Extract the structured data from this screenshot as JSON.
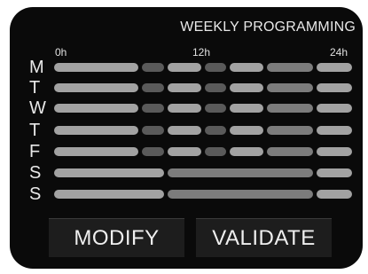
{
  "header": {
    "title": "WEEKLY PROGRAMMING"
  },
  "hours": {
    "start": "0h",
    "mid": "12h",
    "end": "24h"
  },
  "colors": {
    "screen": "#0a0a0a",
    "comfort": "#a2a2a2",
    "eco": "#5a5a5a",
    "mid": "#7c7c7c",
    "text": "#e8e8e8"
  },
  "days": [
    {
      "label": "M",
      "blocks": [
        "comfort",
        "eco",
        "comfort",
        "eco",
        "comfort",
        "mid",
        "comfort"
      ]
    },
    {
      "label": "T",
      "blocks": [
        "comfort",
        "eco",
        "comfort",
        "eco",
        "comfort",
        "mid",
        "comfort"
      ]
    },
    {
      "label": "W",
      "blocks": [
        "comfort",
        "eco",
        "comfort",
        "eco",
        "comfort",
        "mid",
        "comfort"
      ]
    },
    {
      "label": "T",
      "blocks": [
        "comfort",
        "eco",
        "comfort",
        "eco",
        "comfort",
        "mid",
        "comfort"
      ]
    },
    {
      "label": "F",
      "blocks": [
        "comfort",
        "eco",
        "comfort",
        "eco",
        "comfort",
        "mid",
        "comfort"
      ]
    },
    {
      "label": "S",
      "blocks": [
        "comfort",
        "mid",
        "comfort"
      ]
    },
    {
      "label": "S",
      "blocks": [
        "comfort",
        "mid",
        "comfort"
      ]
    }
  ],
  "buttons": {
    "modify": "MODIFY",
    "validate": "VALIDATE"
  }
}
